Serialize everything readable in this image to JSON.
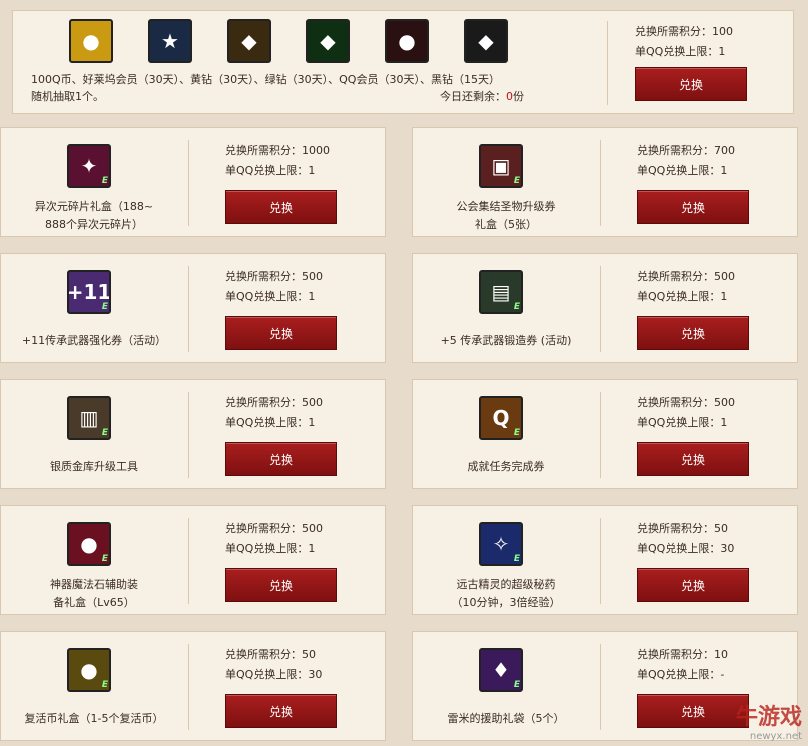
{
  "colors": {
    "button": "#8f1616",
    "remaining": "#c01010",
    "background": "#e7dccc",
    "panel": "#f7f0e4"
  },
  "top": {
    "icons": [
      {
        "name": "gold-coin-icon",
        "bg": "#c99a12",
        "glyph": "●"
      },
      {
        "name": "blue-star-icon",
        "bg": "#1b2a44",
        "glyph": "★"
      },
      {
        "name": "yellow-diamond-icon",
        "bg": "#3a2a10",
        "glyph": "◆"
      },
      {
        "name": "green-diamond-icon",
        "bg": "#0f2f12",
        "glyph": "◆"
      },
      {
        "name": "qq-penguin-icon",
        "bg": "#2a1010",
        "glyph": "●"
      },
      {
        "name": "black-diamond-icon",
        "bg": "#1a1a1a",
        "glyph": "◆"
      }
    ],
    "prize_line1": "100Q币、好莱坞会员（30天）、黄钻（30天）、绿钻（30天）、QQ会员（30天）、黑钻（15天）",
    "prize_line2": "随机抽取1个。",
    "remain_label": "今日还剩余：",
    "remain_value": "0",
    "remain_unit": "份",
    "points_label": "兑换所需积分：100",
    "limit_label": "单QQ兑换上限：1",
    "button_label": "兑换"
  },
  "cards": [
    {
      "name_lines": [
        "异次元碎片礼盒（188~",
        "888个异次元碎片）"
      ],
      "icon_name": "dimension-gift-box-icon",
      "icon_bg": "#5a1030",
      "icon_glyph": "✦",
      "points": "兑换所需积分：1000",
      "limit": "单QQ兑换上限：1",
      "button": "兑换"
    },
    {
      "name_lines": [
        "公会集结圣物升级券",
        "礼盒（5张）"
      ],
      "icon_name": "guild-relic-box-icon",
      "icon_bg": "#5a2020",
      "icon_glyph": "▣",
      "points": "兑换所需积分：700",
      "limit": "单QQ兑换上限：1",
      "button": "兑换"
    },
    {
      "name_lines": [
        "+11传承武器强化券（活动）"
      ],
      "icon_name": "weapon-enhance-ticket-icon",
      "icon_bg": "#4a2a70",
      "icon_glyph": "+11",
      "points": "兑换所需积分：500",
      "limit": "单QQ兑换上限：1",
      "button": "兑换"
    },
    {
      "name_lines": [
        "+5 传承武器锻造券 (活动)"
      ],
      "icon_name": "weapon-forge-ticket-icon",
      "icon_bg": "#2a3a2a",
      "icon_glyph": "▤",
      "points": "兑换所需积分：500",
      "limit": "单QQ兑换上限：1",
      "button": "兑换"
    },
    {
      "name_lines": [
        "银质金库升级工具"
      ],
      "icon_name": "silver-vault-chest-icon",
      "icon_bg": "#4a3a2a",
      "icon_glyph": "▥",
      "points": "兑换所需积分：500",
      "limit": "单QQ兑换上限：1",
      "button": "兑换"
    },
    {
      "name_lines": [
        "成就任务完成券"
      ],
      "icon_name": "quest-clear-ticket-icon",
      "icon_bg": "#6a3a10",
      "icon_glyph": "Q",
      "points": "兑换所需积分：500",
      "limit": "单QQ兑换上限：1",
      "button": "兑换"
    },
    {
      "name_lines": [
        "神器魔法石辅助装",
        "备礼盒（Lv65）"
      ],
      "icon_name": "magic-stone-gift-icon",
      "icon_bg": "#6a1020",
      "icon_glyph": "●",
      "points": "兑换所需积分：500",
      "limit": "单QQ兑换上限：1",
      "button": "兑换"
    },
    {
      "name_lines": [
        "远古精灵的超级秘药",
        "（10分钟，3倍经验）"
      ],
      "icon_name": "ancient-elixir-icon",
      "icon_bg": "#1a2a6a",
      "icon_glyph": "✧",
      "points": "兑换所需积分：50",
      "limit": "单QQ兑换上限：30",
      "button": "兑换"
    },
    {
      "name_lines": [
        "复活币礼盒（1-5个复活币）"
      ],
      "icon_name": "revive-coin-box-icon",
      "icon_bg": "#5a4a10",
      "icon_glyph": "●",
      "points": "兑换所需积分：50",
      "limit": "单QQ兑换上限：30",
      "button": "兑换"
    },
    {
      "name_lines": [
        "雷米的援助礼袋（5个）"
      ],
      "icon_name": "remy-aid-bag-icon",
      "icon_bg": "#3a1a5a",
      "icon_glyph": "♦",
      "points": "兑换所需积分：10",
      "limit": "单QQ兑换上限：-",
      "button": "兑换"
    }
  ],
  "watermark": {
    "main": "牛游戏",
    "url": "newyx.net"
  }
}
